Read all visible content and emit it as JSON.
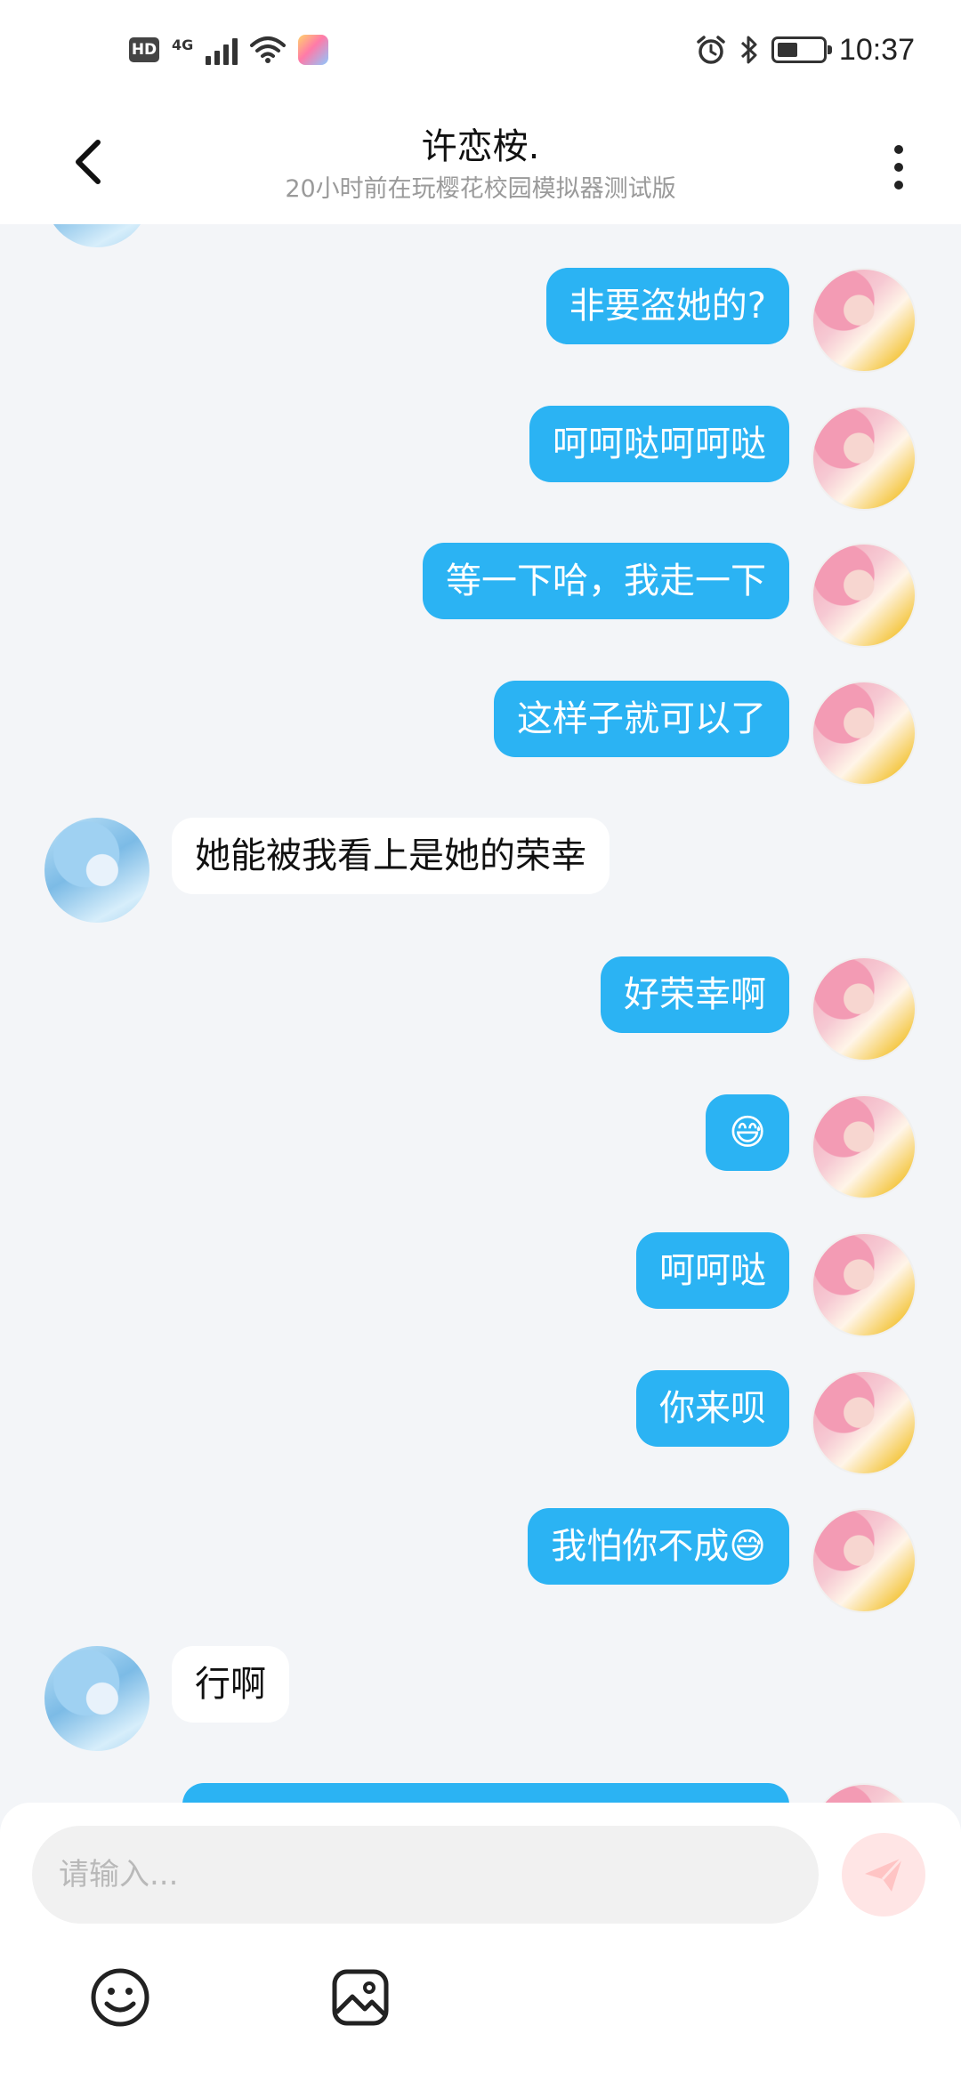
{
  "status_bar": {
    "hd": "HD",
    "network": "4G",
    "time": "10:37",
    "icons": [
      "signal-icon",
      "wifi-icon",
      "app-icon",
      "alarm-icon",
      "bluetooth-icon",
      "battery-icon"
    ]
  },
  "header": {
    "title": "许恋桉.",
    "subtitle": "20小时前在玩樱花校园模拟器测试版"
  },
  "messages": [
    {
      "from": "self",
      "text": "非要盗她的?"
    },
    {
      "from": "self",
      "text": "呵呵哒呵呵哒"
    },
    {
      "from": "self",
      "text": "等一下哈，我走一下"
    },
    {
      "from": "self",
      "text": "这样子就可以了"
    },
    {
      "from": "other",
      "text": "她能被我看上是她的荣幸"
    },
    {
      "from": "self",
      "text": "好荣幸啊"
    },
    {
      "from": "self",
      "text": "😅"
    },
    {
      "from": "self",
      "text": "呵呵哒"
    },
    {
      "from": "self",
      "text": "你来呗"
    },
    {
      "from": "self",
      "text": "我怕你不成😅"
    },
    {
      "from": "other",
      "text": "行啊"
    }
  ],
  "input": {
    "placeholder": "请输入..."
  },
  "colors": {
    "self_bubble": "#2bb3f3",
    "other_bubble": "#ffffff",
    "background": "#f3f5f8",
    "send_button": "#ffe5e5"
  }
}
